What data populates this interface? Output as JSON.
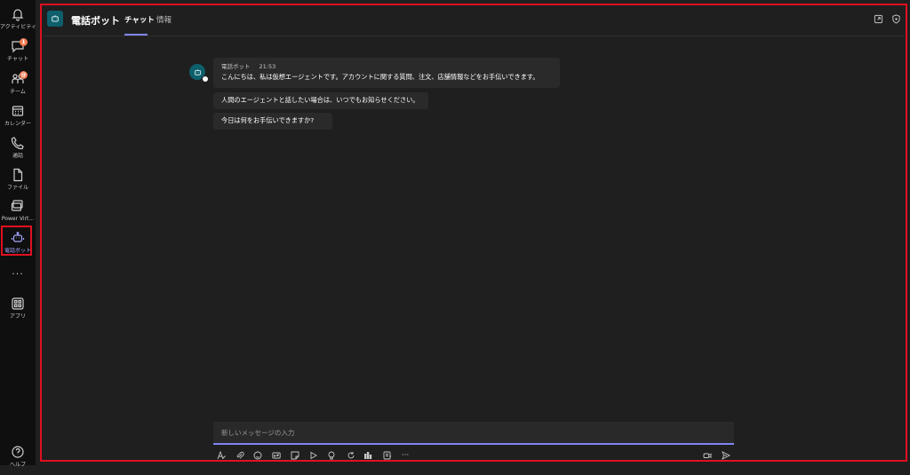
{
  "rail": {
    "items": [
      {
        "label": "アクティビティ",
        "icon": "bell-icon"
      },
      {
        "label": "チャット",
        "icon": "chat-icon",
        "badge": "1"
      },
      {
        "label": "チーム",
        "icon": "teams-icon",
        "badge": "@"
      },
      {
        "label": "カレンダー",
        "icon": "calendar-icon"
      },
      {
        "label": "通話",
        "icon": "phone-icon"
      },
      {
        "label": "ファイル",
        "icon": "file-icon"
      },
      {
        "label": "Power Virt...",
        "icon": "power-virtual-agents-icon"
      },
      {
        "label": "電話ボット",
        "icon": "bot-icon"
      },
      {
        "label": "アプリ",
        "icon": "apps-icon"
      },
      {
        "label": "ヘルプ",
        "icon": "help-icon"
      }
    ],
    "more": "···"
  },
  "header": {
    "title": "電話ボット",
    "tabs": [
      {
        "label": "チャット"
      },
      {
        "label": "情報"
      }
    ]
  },
  "messages": {
    "sender": "電話ボット",
    "time": "21:53",
    "items": [
      "こんにちは、私は仮想エージェントです。アカウントに関する質問、注文、店舗情報などをお手伝いできます。",
      "人間のエージェントと話したい場合は、いつでもお知らせください。",
      "今日は何をお手伝いできますか?"
    ]
  },
  "compose": {
    "placeholder": "新しいメッセージの入力",
    "more": "···"
  },
  "colors": {
    "accent": "#7f85f5",
    "highlight_border": "#e0101f",
    "bot_avatar": "#0e5f6c",
    "badge": "#f07b52"
  }
}
